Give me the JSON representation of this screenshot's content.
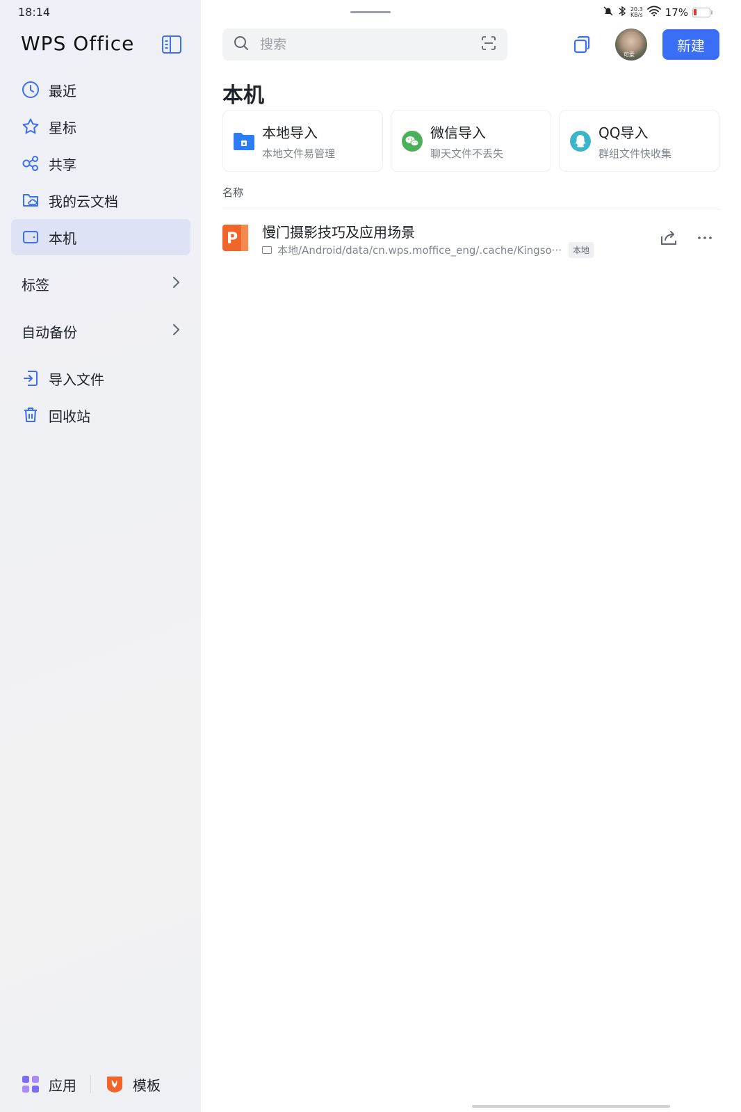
{
  "status_bar": {
    "time": "18:14",
    "network_speed": "20.3",
    "network_unit": "KB/s",
    "battery": "17%"
  },
  "sidebar": {
    "brand": "WPS Office",
    "items": [
      {
        "label": "最近",
        "icon": "clock-icon"
      },
      {
        "label": "星标",
        "icon": "star-icon"
      },
      {
        "label": "共享",
        "icon": "share-nodes-icon"
      },
      {
        "label": "我的云文档",
        "icon": "cloud-folder-icon"
      },
      {
        "label": "本机",
        "icon": "tablet-icon",
        "active": true
      }
    ],
    "groups": [
      {
        "label": "标签"
      },
      {
        "label": "自动备份"
      }
    ],
    "items2": [
      {
        "label": "导入文件",
        "icon": "import-icon"
      },
      {
        "label": "回收站",
        "icon": "trash-icon"
      }
    ],
    "bottom": [
      {
        "label": "应用",
        "icon": "apps-icon"
      },
      {
        "label": "模板",
        "icon": "template-icon"
      }
    ]
  },
  "header": {
    "search_placeholder": "搜索",
    "avatar_tag": "可爱",
    "new_label": "新建"
  },
  "main": {
    "title": "本机",
    "cards": [
      {
        "title": "本地导入",
        "subtitle": "本地文件易管理",
        "icon": "folder-icon"
      },
      {
        "title": "微信导入",
        "subtitle": "聊天文件不丢失",
        "icon": "wechat-icon"
      },
      {
        "title": "QQ导入",
        "subtitle": "群组文件快收集",
        "icon": "qq-icon"
      }
    ],
    "column_name": "名称",
    "files": [
      {
        "name": "慢门摄影技巧及应用场景",
        "path": "本地/Android/data/cn.wps.moffice_eng/.cache/Kingso···",
        "badge": "本地",
        "type_letter": "P"
      }
    ]
  },
  "colors": {
    "accent": "#3b6ef6",
    "active_nav_bg": "#dde2f4",
    "ppt_orange": "#f0662a",
    "wechat_green": "#4cb05a",
    "qq_teal": "#3ab5c9",
    "folder_blue": "#2b7cf6"
  }
}
